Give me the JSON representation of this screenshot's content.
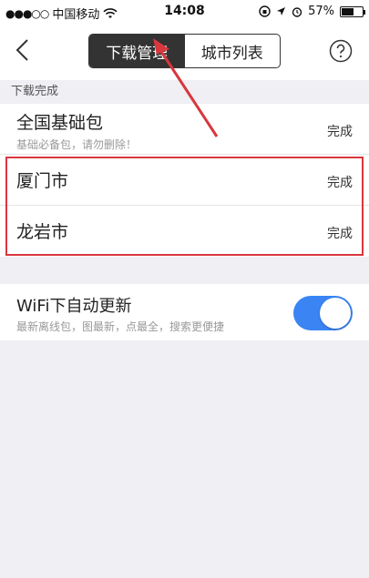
{
  "status_bar": {
    "signal": "●●●○○",
    "carrier": "中国移动",
    "time": "14:08",
    "battery": "57%",
    "battery_level": 0.57
  },
  "nav": {
    "tabs": [
      {
        "label": "下载管理",
        "active": true
      },
      {
        "label": "城市列表",
        "active": false
      }
    ],
    "icons": [
      "back-chevron-icon",
      "help-icon"
    ]
  },
  "section": {
    "label": "下载完成"
  },
  "items": [
    {
      "title": "全国基础包",
      "subtitle": "基础必备包，请勿删除！",
      "status": "完成"
    },
    {
      "title": "厦门市",
      "status": "完成"
    },
    {
      "title": "龙岩市",
      "status": "完成"
    }
  ],
  "wifi_setting": {
    "title": "WiFi下自动更新",
    "subtitle": "最新离线包，图最新，点最全，搜索更便捷",
    "enabled": true
  },
  "colors": {
    "accent": "#3a84f4",
    "annotation": "#d8373e"
  }
}
